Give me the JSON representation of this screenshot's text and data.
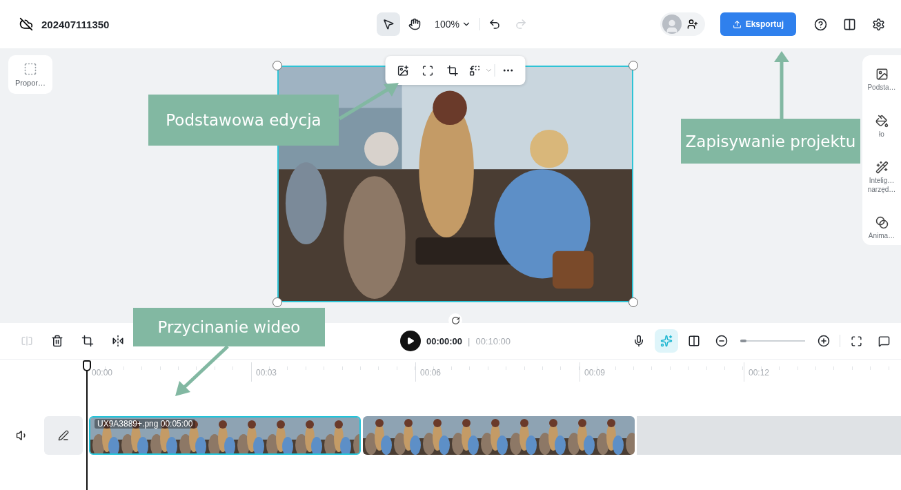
{
  "header": {
    "project_name": "202407111350",
    "tools": [
      {
        "kind": "select",
        "selected": true
      },
      {
        "kind": "hand",
        "selected": false
      }
    ],
    "zoom": "100%",
    "history": [
      {
        "kind": "undo",
        "disabled": false
      },
      {
        "kind": "redo",
        "disabled": true
      }
    ],
    "export_label": "Eksportuj"
  },
  "left_panel": {
    "items": [
      {
        "label": "Propor…"
      }
    ]
  },
  "right_panel": {
    "items": [
      {
        "kind": "basic",
        "label": "Podsta…"
      },
      {
        "kind": "background",
        "label": "ło"
      },
      {
        "kind": "smart",
        "label": "Intelig… narzęd…"
      },
      {
        "kind": "animation",
        "label": "Anima…"
      }
    ]
  },
  "timeline": {
    "left_tools": [
      {
        "kind": "split",
        "disabled": true
      },
      {
        "kind": "delete",
        "disabled": false
      },
      {
        "kind": "crop",
        "disabled": false
      },
      {
        "kind": "flip",
        "disabled": false
      }
    ],
    "current_time": "00:00:00",
    "separator": "|",
    "duration": "00:10:00",
    "right_tools": [
      {
        "kind": "mic",
        "selected": false
      },
      {
        "kind": "auto",
        "selected": true
      },
      {
        "kind": "split",
        "selected": false
      }
    ],
    "zoom": {
      "level": 0.1
    },
    "ruler": [
      "00:00",
      "00:03",
      "00:06",
      "00:09",
      "00:12"
    ],
    "clips": [
      {
        "name": "UX9A3889+.png",
        "duration": "00:05:00",
        "selected": true
      },
      {
        "selected": false
      }
    ]
  },
  "annotations": [
    {
      "text": "Podstawowa edycja"
    },
    {
      "text": "Zapisywanie projektu"
    },
    {
      "text": "Przycinanie wideo"
    }
  ]
}
